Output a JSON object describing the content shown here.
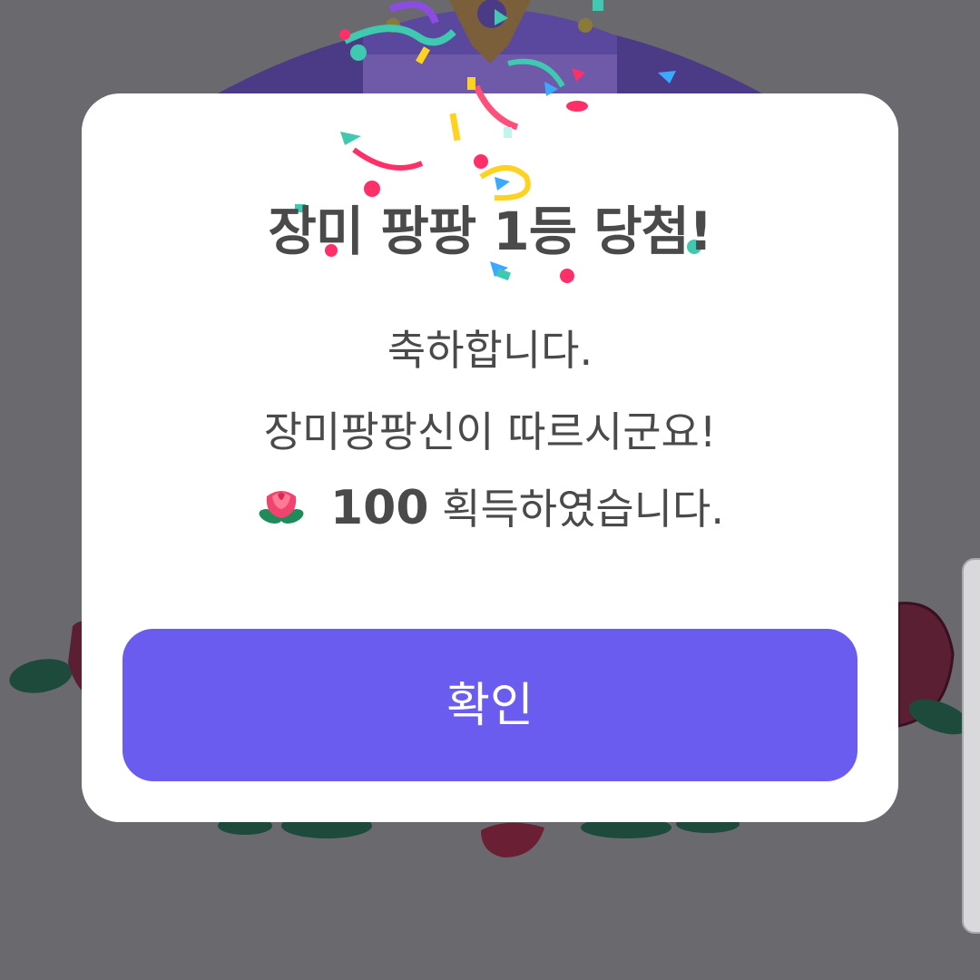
{
  "dialog": {
    "title": "장미 팡팡 1등 당첨!",
    "message_line1": "축하합니다.",
    "message_line2": "장미팡팡신이 따르시군요!",
    "reward_amount": "100",
    "reward_suffix": "획득하였습니다.",
    "reward_icon": "rose-icon",
    "confirm_label": "확인"
  },
  "colors": {
    "overlay": "#6a696e",
    "button": "#6b5cf0",
    "title_text": "#4a4a4a",
    "wheel": "#4a3a86"
  }
}
